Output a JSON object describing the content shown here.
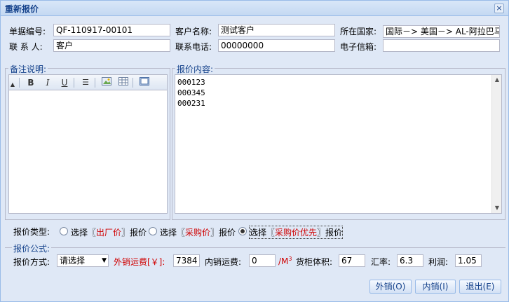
{
  "window": {
    "title": "重新报价",
    "close": "×"
  },
  "form": {
    "bill_no_label": "单据编号:",
    "bill_no_value": "QF-110917-00101",
    "customer_name_label": "客户名称:",
    "customer_name_value": "测试客户",
    "country_label": "所在国家:",
    "country_value": "国际－> 美国－> AL-阿拉巴马",
    "contact_label": "联 系 人:",
    "contact_value": "客户",
    "phone_label": "联系电话:",
    "phone_value": "00000000",
    "email_label": "电子信箱:",
    "email_value": ""
  },
  "remarks": {
    "legend": "备注说明:"
  },
  "quote_content": {
    "legend": "报价内容:",
    "lines": [
      "000123",
      "000345",
      "000231"
    ]
  },
  "quote_type": {
    "label": "报价类型:",
    "options": [
      {
        "prefix": "选择〖",
        "name": "出厂价",
        "suffix": "〗报价",
        "checked": false
      },
      {
        "prefix": "选择〖",
        "name": "采购价",
        "suffix": "〗报价",
        "checked": false
      },
      {
        "prefix": "选择〖",
        "name": "采购价优先",
        "suffix": "〗报价",
        "checked": true
      }
    ]
  },
  "formula": {
    "legend": "报价公式:",
    "method_label": "报价方式:",
    "method_value": "请选择",
    "export_freight_label": "外销运费[￥]:",
    "export_freight_value": "7384",
    "domestic_freight_label": "内销运费:",
    "domestic_freight_value": "0",
    "unit": "/M",
    "unit_sup": "3",
    "volume_label": "货柜体积:",
    "volume_value": "67",
    "rate_label": "汇率:",
    "rate_value": "6.3",
    "profit_label": "利润:",
    "profit_value": "1.05"
  },
  "buttons": {
    "export": "外销(O)",
    "domestic": "内销(I)",
    "exit": "退出(E)"
  },
  "colors": {
    "title": "#15428b",
    "highlight": "#d00000",
    "panel": "#dfe8f6"
  }
}
